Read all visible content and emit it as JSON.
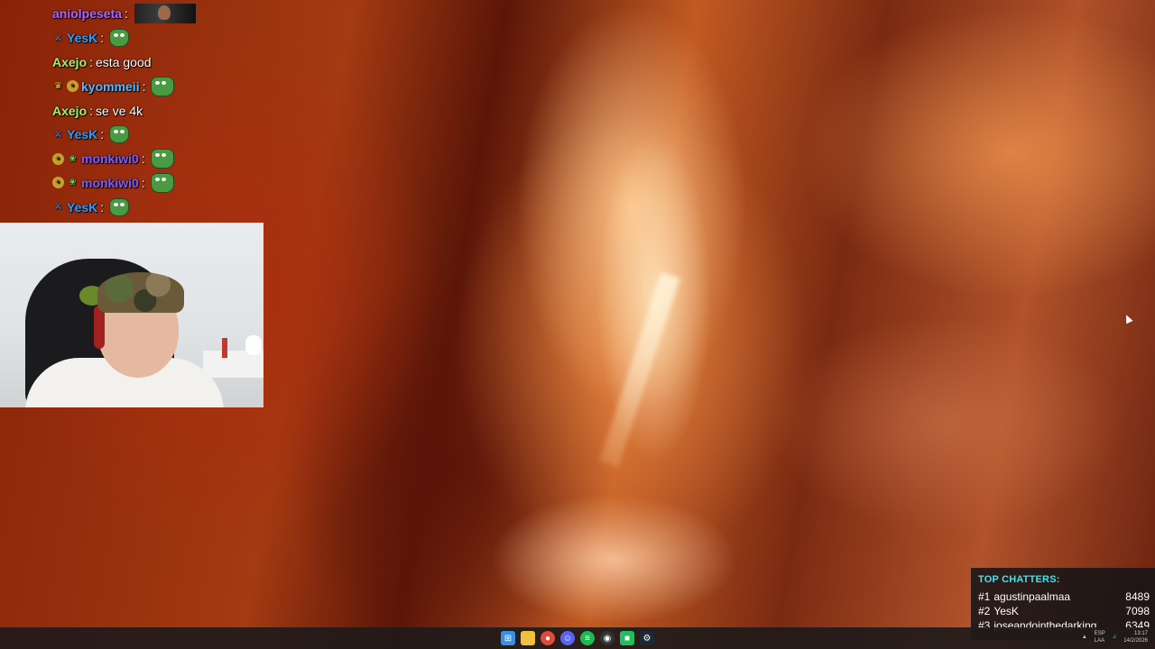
{
  "chat": {
    "messages": [
      {
        "user": "aniolpeseta",
        "text": "",
        "color": "#b063ff",
        "badges": [],
        "emote": "image-thumbnail"
      },
      {
        "user": "YesK",
        "text": "",
        "color": "#2e9cff",
        "badges": [
          "sword-badge"
        ],
        "emote": "pepe-emote"
      },
      {
        "user": "Axejo",
        "text": "esta good",
        "color": "#a6f06a",
        "badges": [],
        "emote": ""
      },
      {
        "user": "kyommeii",
        "text": "",
        "color": "#5bb8ff",
        "badges": [
          "crown-badge",
          "coin-badge"
        ],
        "emote": "pepe-emote"
      },
      {
        "user": "Axejo",
        "text": "se ve 4k",
        "color": "#a6f06a",
        "badges": [],
        "emote": ""
      },
      {
        "user": "YesK",
        "text": "",
        "color": "#2e9cff",
        "badges": [
          "sword-badge"
        ],
        "emote": "pepe-emote"
      },
      {
        "user": "monkiwi0",
        "text": "",
        "color": "#7a5cff",
        "badges": [
          "coin-badge",
          "frog-badge"
        ],
        "emote": "pepe-emote"
      },
      {
        "user": "monkiwi0",
        "text": "",
        "color": "#7a5cff",
        "badges": [
          "coin-badge",
          "frog-badge"
        ],
        "emote": "pepe-emote"
      },
      {
        "user": "YesK",
        "text": "",
        "color": "#2e9cff",
        "badges": [
          "sword-badge"
        ],
        "emote": "pepe-emote"
      }
    ]
  },
  "top_chatters": {
    "title": "TOP CHATTERS:",
    "accent": "#3ee4ee",
    "rows": [
      {
        "rank": "#1",
        "name": "agustinpaalmaa",
        "count": "8489"
      },
      {
        "rank": "#2",
        "name": "YesK",
        "count": "7098"
      },
      {
        "rank": "#3",
        "name": "joseandointhedarking",
        "count": "6349"
      }
    ]
  },
  "taskbar": {
    "icons": [
      "windows-start-icon",
      "file-explorer-icon",
      "chrome-icon",
      "discord-icon",
      "spotify-icon",
      "obs-icon",
      "app-green-icon",
      "steam-icon"
    ],
    "tray_lang": "ESP\nLAA",
    "time": "13:17",
    "date": "14/2/2026"
  }
}
